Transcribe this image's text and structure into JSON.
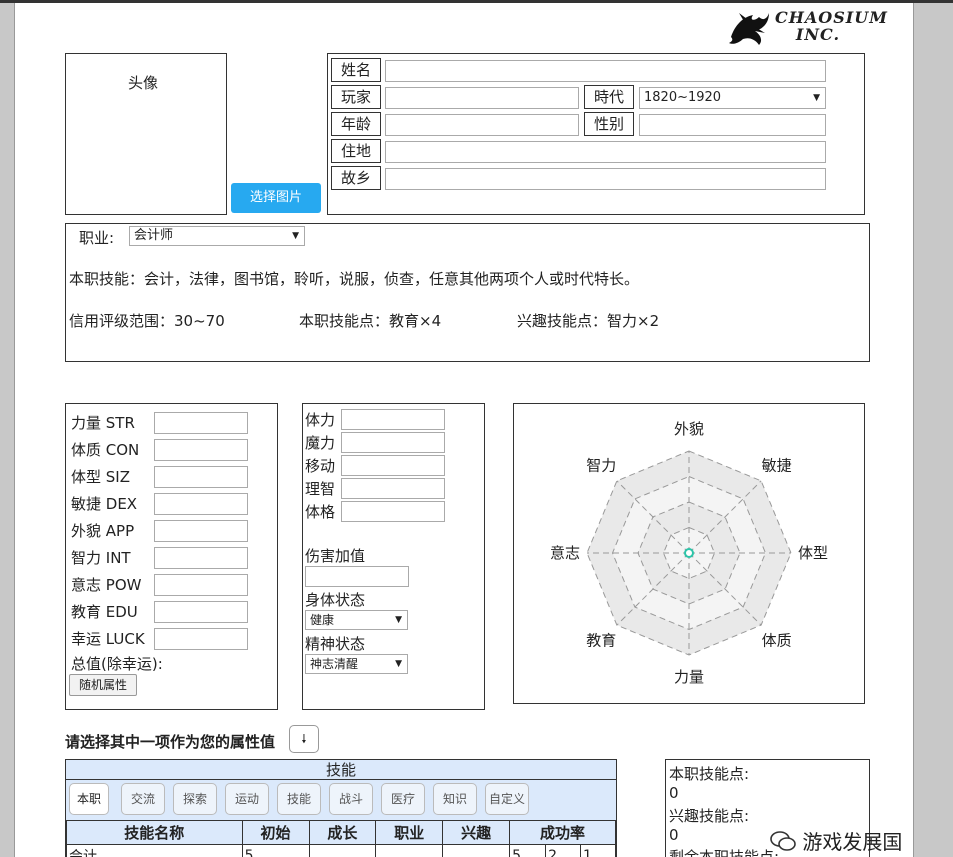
{
  "logo": {
    "text": "CHAOSIUM INC."
  },
  "avatar": {
    "label": "头像",
    "upload_button": "选择图片"
  },
  "basic": {
    "name_label": "姓名",
    "player_label": "玩家",
    "era_label": "時代",
    "era_value": "1820~1920",
    "age_label": "年龄",
    "gender_label": "性别",
    "residence_label": "住地",
    "hometown_label": "故乡"
  },
  "occupation": {
    "label": "职业:",
    "value": "会计师",
    "skills_text": "本职技能：会计，法律，图书馆，聆听，说服，侦查，任意其他两项个人或时代特长。",
    "credit_range": "信用评级范围：30~70",
    "occ_points": "本职技能点：教育×4",
    "interest_points": "兴趣技能点：智力×2"
  },
  "attributes": {
    "items": [
      {
        "label": "力量 STR"
      },
      {
        "label": "体质 CON"
      },
      {
        "label": "体型 SIZ"
      },
      {
        "label": "敏捷 DEX"
      },
      {
        "label": "外貌 APP"
      },
      {
        "label": "智力 INT"
      },
      {
        "label": "意志 POW"
      },
      {
        "label": "教育 EDU"
      },
      {
        "label": "幸运 LUCK"
      }
    ],
    "total_label": "总值(除幸运):",
    "random_button": "随机属性"
  },
  "derived": {
    "hp": "体力",
    "mp": "魔力",
    "move": "移动",
    "sanity": "理智",
    "build": "体格",
    "damage_bonus": "伤害加值",
    "body_status_label": "身体状态",
    "body_status_value": "健康",
    "mental_status_label": "精神状态",
    "mental_status_value": "神志清醒"
  },
  "radar": {
    "labels": [
      "外貌",
      "敏捷",
      "体型",
      "体质",
      "力量",
      "教育",
      "意志",
      "智力"
    ]
  },
  "choose_prompt": "请选择其中一项作为您的属性值",
  "skills_panel": {
    "title": "技能",
    "tabs": [
      "本职",
      "交流",
      "探索",
      "运动",
      "技能",
      "战斗",
      "医疗",
      "知识",
      "自定义"
    ],
    "columns": [
      "技能名称",
      "初始",
      "成长",
      "职业",
      "兴趣",
      "成功率"
    ],
    "rows": [
      {
        "name": "会计",
        "base": "5",
        "growth": "",
        "occ": "",
        "interest": "",
        "rate_full": "5",
        "rate_half": "2",
        "rate_fifth": "1"
      }
    ]
  },
  "points_panel": {
    "occ_label": "本职技能点:",
    "occ_value": "0",
    "interest_label": "兴趣技能点:",
    "interest_value": "0",
    "remaining_label": "剩余本职技能点:"
  },
  "watermark": "游戏发展国",
  "colors": {
    "accent": "#27a9f0",
    "table_header": "#dbe9fb",
    "radar_center": "#2cc4a8"
  }
}
